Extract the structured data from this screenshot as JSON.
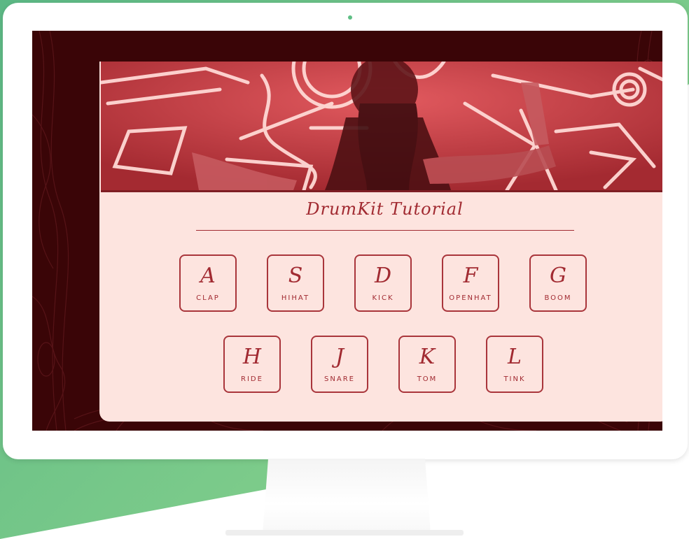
{
  "app": {
    "title": "DrumKit Tutorial"
  },
  "keys": [
    {
      "key": "A",
      "sound": "CLAP"
    },
    {
      "key": "S",
      "sound": "HIHAT"
    },
    {
      "key": "D",
      "sound": "KICK"
    },
    {
      "key": "F",
      "sound": "OPENHAT"
    },
    {
      "key": "G",
      "sound": "BOOM"
    },
    {
      "key": "H",
      "sound": "RIDE"
    },
    {
      "key": "J",
      "sound": "SNARE"
    },
    {
      "key": "K",
      "sound": "TOM"
    },
    {
      "key": "L",
      "sound": "TINK"
    }
  ],
  "colors": {
    "accent": "#a12a31",
    "card_bg": "#fde4df",
    "page_bg": "#3a0507",
    "hero_tint": "#b2333b",
    "backdrop": "#6cc288"
  }
}
